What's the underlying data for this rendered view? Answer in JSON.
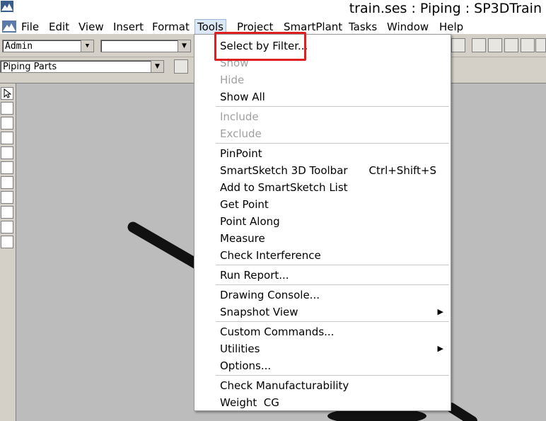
{
  "window": {
    "title": "train.ses : Piping : SP3DTrain"
  },
  "menubar": {
    "items": [
      {
        "label": "File"
      },
      {
        "label": "Edit"
      },
      {
        "label": "View"
      },
      {
        "label": "Insert"
      },
      {
        "label": "Format"
      },
      {
        "label": "Tools"
      },
      {
        "label": "Project"
      },
      {
        "label": "SmartPlant"
      },
      {
        "label": "Tasks"
      },
      {
        "label": "Window"
      },
      {
        "label": "Help"
      }
    ],
    "active": "Tools"
  },
  "toolbar": {
    "permission_group": "Admin",
    "second_combo": "",
    "locate_filter": "Piping Parts"
  },
  "tools_menu": {
    "items": [
      {
        "label": "Select by Filter...",
        "enabled": true,
        "highlighted": true
      },
      {
        "label": "Show",
        "enabled": false
      },
      {
        "label": "Hide",
        "enabled": false
      },
      {
        "label": "Show All",
        "enabled": true
      },
      {
        "label": "Include",
        "enabled": false
      },
      {
        "label": "Exclude",
        "enabled": false
      },
      {
        "label": "PinPoint",
        "enabled": true
      },
      {
        "label": "SmartSketch 3D Toolbar",
        "enabled": true,
        "shortcut": "Ctrl+Shift+S"
      },
      {
        "label": "Add to SmartSketch List",
        "enabled": true
      },
      {
        "label": "Get Point",
        "enabled": true
      },
      {
        "label": "Point Along",
        "enabled": true
      },
      {
        "label": "Measure",
        "enabled": true
      },
      {
        "label": "Check Interference",
        "enabled": true
      },
      {
        "label": "Run Report...",
        "enabled": true
      },
      {
        "label": "Drawing Console...",
        "enabled": true
      },
      {
        "label": "Snapshot View",
        "enabled": true,
        "submenu": true
      },
      {
        "label": "Custom Commands...",
        "enabled": true
      },
      {
        "label": "Utilities",
        "enabled": true,
        "submenu": true
      },
      {
        "label": "Options...",
        "enabled": true
      },
      {
        "label": "Check Manufacturability",
        "enabled": true
      },
      {
        "label": "Weight  CG",
        "enabled": true
      }
    ]
  },
  "colors": {
    "highlight_box": "#e02020",
    "menu_disabled": "#a0a0a0",
    "viewport_bg": "#bcbcbc"
  }
}
